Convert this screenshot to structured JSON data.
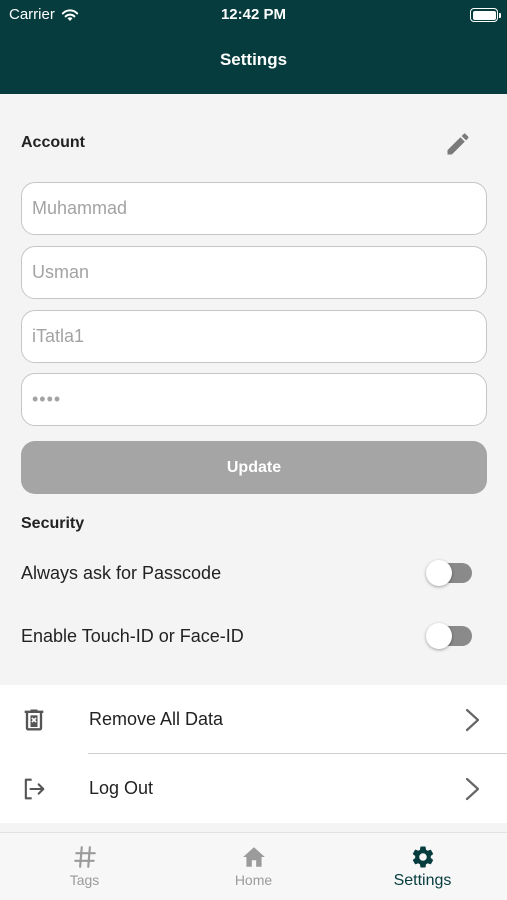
{
  "status_bar": {
    "carrier": "Carrier",
    "time": "12:42 PM"
  },
  "header": {
    "title": "Settings"
  },
  "account": {
    "section_title": "Account",
    "first_name": "Muhammad",
    "last_name": "Usman",
    "username": "iTatla1",
    "password_masked": "••••",
    "update_label": "Update"
  },
  "security": {
    "section_title": "Security",
    "passcode_label": "Always ask for Passcode",
    "passcode_enabled": false,
    "biometric_label": "Enable Touch-ID or Face-ID",
    "biometric_enabled": false
  },
  "actions": {
    "remove_label": "Remove All Data",
    "logout_label": "Log Out"
  },
  "tabs": {
    "tags": "Tags",
    "home": "Home",
    "settings": "Settings",
    "active": "Settings"
  },
  "colors": {
    "header": "#063c3e",
    "accent": "#063c3e",
    "button_disabled": "#a5a5a5"
  }
}
